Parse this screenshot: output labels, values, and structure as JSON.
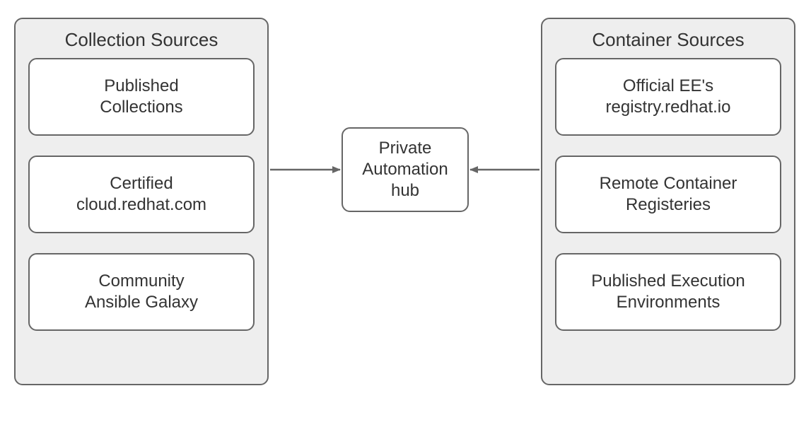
{
  "diagram": {
    "left_group": {
      "title": "Collection Sources",
      "items": [
        {
          "line1": "Published",
          "line2": "Collections"
        },
        {
          "line1": "Certified",
          "line2": "cloud.redhat.com"
        },
        {
          "line1": "Community",
          "line2": "Ansible Galaxy"
        }
      ]
    },
    "right_group": {
      "title": "Container Sources",
      "items": [
        {
          "line1": "Official EE's",
          "line2": "registry.redhat.io"
        },
        {
          "line1": "Remote Container",
          "line2": "Registeries"
        },
        {
          "line1": "Published Execution",
          "line2": "Environments"
        }
      ]
    },
    "center": {
      "line1": "Private",
      "line2": "Automation",
      "line3": "hub"
    }
  },
  "colors": {
    "stroke": "#666666",
    "group_fill": "#eeeeee",
    "node_fill": "#ffffff"
  }
}
